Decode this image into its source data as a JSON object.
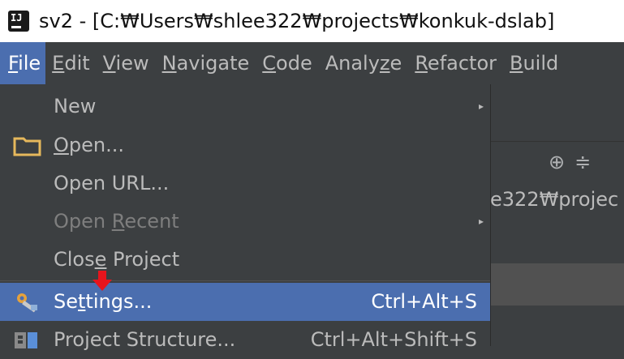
{
  "window": {
    "title": "sv2 - [C:₩Users₩shlee322₩projects₩konkuk-dslab]"
  },
  "menubar": {
    "items": [
      {
        "id": "file",
        "text": "File",
        "mnemonic": "F",
        "rest": "ile"
      },
      {
        "id": "edit",
        "text": "Edit",
        "mnemonic": "E",
        "rest": "dit"
      },
      {
        "id": "view",
        "text": "View",
        "mnemonic": "V",
        "rest": "iew"
      },
      {
        "id": "navigate",
        "text": "Navigate",
        "mnemonic": "N",
        "rest": "avigate"
      },
      {
        "id": "code",
        "text": "Code",
        "mnemonic": "C",
        "rest": "ode"
      },
      {
        "id": "analyze",
        "text": "Analyze",
        "pre": "Analy",
        "mnemonic": "z",
        "rest": "e"
      },
      {
        "id": "refactor",
        "text": "Refactor",
        "mnemonic": "R",
        "rest": "efactor"
      },
      {
        "id": "build",
        "text": "Build",
        "mnemonic": "B",
        "rest": "uild"
      }
    ]
  },
  "file_menu": {
    "new": {
      "label": "New"
    },
    "open": {
      "mnemonic": "O",
      "rest": "pen..."
    },
    "open_url": {
      "label": "Open URL..."
    },
    "open_recent": {
      "pre": "Open ",
      "mnemonic": "R",
      "rest": "ecent"
    },
    "close_project": {
      "pre": "Clos",
      "mnemonic": "e",
      "rest": " Project"
    },
    "settings": {
      "pre": "Se",
      "mnemonic": "t",
      "rest": "tings...",
      "shortcut": "Ctrl+Alt+S"
    },
    "project_structure": {
      "label": "Project Structure...",
      "shortcut": "Ctrl+Alt+Shift+S"
    }
  },
  "background": {
    "path_fragment": "e322₩projec"
  },
  "colors": {
    "selection": "#4b6eaf",
    "menu_bg": "#3c3f41",
    "arrow": "#e8141c"
  }
}
